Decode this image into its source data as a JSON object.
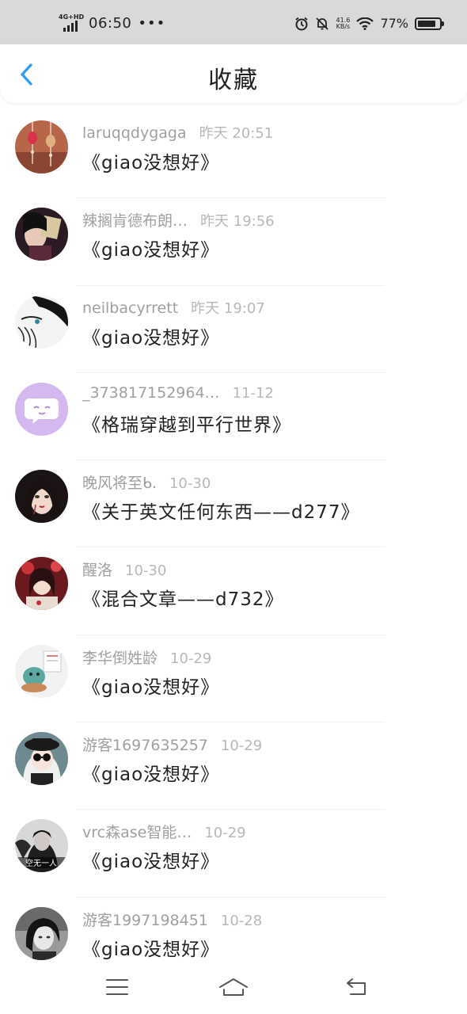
{
  "status_bar": {
    "network": "4G+HD",
    "time": "06:50",
    "dots": "•••",
    "speed_value": "41.6",
    "speed_unit": "KB/s",
    "battery": "77%"
  },
  "header": {
    "title": "收藏",
    "back_icon": "chevron-left-icon"
  },
  "colors": {
    "accent": "#2b9cf2",
    "status_bg": "#d9d9d9",
    "name_gray": "#a0a0a0",
    "time_gray": "#b8b8b8"
  },
  "favorites": [
    {
      "user": "laruqqdygaga",
      "time": "昨天 20:51",
      "title": "《giao没想好》"
    },
    {
      "user": "辣搁肯德布朗…",
      "time": "昨天 19:56",
      "title": "《giao没想好》"
    },
    {
      "user": "neilbacyrrett",
      "time": "昨天 19:07",
      "title": "《giao没想好》"
    },
    {
      "user": "_373817152964…",
      "time": "11-12",
      "title": "《格瑞穿越到平行世界》"
    },
    {
      "user": "晚风将至ᑲ.",
      "time": "10-30",
      "title": "《关于英文任何东西——d277》"
    },
    {
      "user": "醒洛",
      "time": "10-30",
      "title": "《混合文章——d732》"
    },
    {
      "user": "李华倒姓龄",
      "time": "10-29",
      "title": "《giao没想好》"
    },
    {
      "user": "游客1697635257",
      "time": "10-29",
      "title": "《giao没想好》"
    },
    {
      "user": "vrc森ase智能…",
      "time": "10-29",
      "title": "《giao没想好》",
      "avatar_text": "空无一人"
    },
    {
      "user": "游客1997198451",
      "time": "10-28",
      "title": "《giao没想好》"
    }
  ],
  "nav": {
    "menu_icon": "menu-icon",
    "home_icon": "home-icon",
    "back_icon": "return-icon"
  }
}
